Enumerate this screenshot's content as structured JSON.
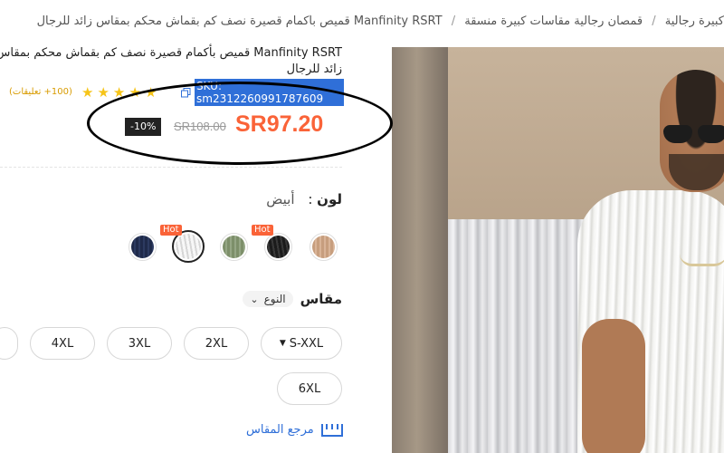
{
  "breadcrumb": {
    "items": [
      "كبيرة رجالية",
      "قمصان رجالية مقاسات كبيرة منسقة",
      "Manfinity RSRT قميص بأكمام قصيرة نصف كم بقماش محكم بمقاس زائد للرجال"
    ],
    "separator": "/"
  },
  "product": {
    "title": "Manfinity RSRT قميص بأكمام قصيرة نصف كم بقماش محكم بمقاس زائد للرجال",
    "sku": "SKU: sm2312260991787609",
    "rating_stars": 5,
    "reviews": "(100+ تعليقات)",
    "price": "SR97.20",
    "old_price": "SR108.00",
    "discount": "-10%"
  },
  "color": {
    "label": "لون",
    "separator": ":",
    "selected": "أبيض",
    "hot_badge": "Hot",
    "swatches": [
      {
        "name": "navy",
        "color": "#1f2a4a",
        "hot": false
      },
      {
        "name": "white",
        "color": "#e9e9e9",
        "hot": true,
        "selected": true
      },
      {
        "name": "sage-green",
        "color": "#7d8f6a",
        "hot": false
      },
      {
        "name": "black",
        "color": "#1b1b1b",
        "hot": true
      },
      {
        "name": "tan",
        "color": "#c79e7e",
        "hot": false
      }
    ]
  },
  "size": {
    "label": "مقاس",
    "type_select": "النوع",
    "options": [
      "S-XXL",
      "2XL",
      "3XL",
      "4XL",
      "6XL"
    ],
    "guide": "مرجع المقاس"
  },
  "colors": {
    "accent": "#fa6338",
    "link": "#2f6fd8",
    "star": "#f6c418"
  }
}
